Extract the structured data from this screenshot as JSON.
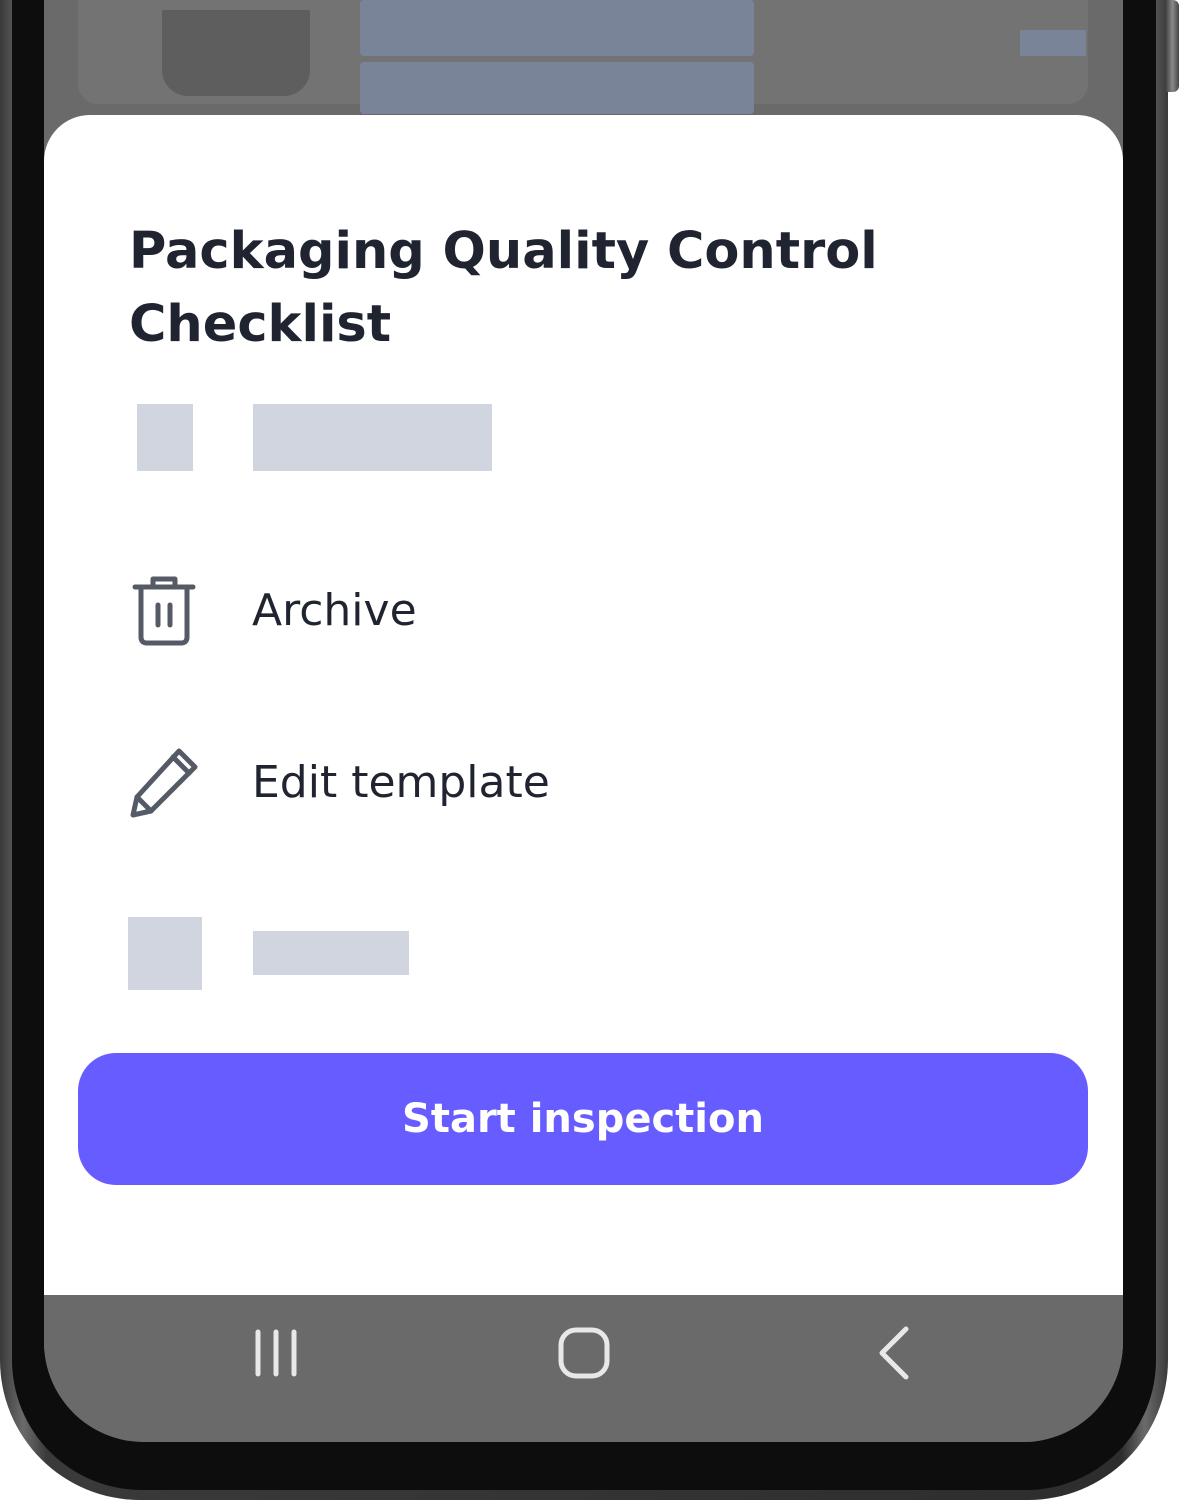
{
  "sheet": {
    "title": "Packaging Quality Control Checklist",
    "menu": [
      {
        "label": "Archive",
        "icon": "trash-icon"
      },
      {
        "label": "Edit template",
        "icon": "pencil-icon"
      }
    ],
    "primary_button_label": "Start inspection"
  },
  "navbar": {
    "icons": [
      "recent-apps-icon",
      "home-icon",
      "back-icon"
    ]
  },
  "colors": {
    "accent": "#675cff",
    "text": "#1f2430",
    "skeleton": "#d0d5df",
    "overlay": "#6a6a6a"
  }
}
